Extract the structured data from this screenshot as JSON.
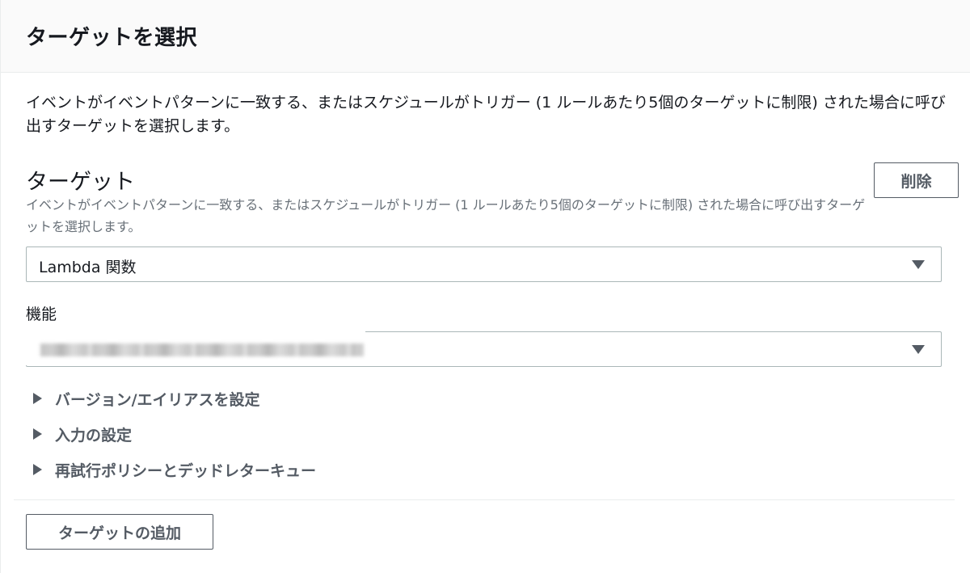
{
  "panel": {
    "title": "ターゲットを選択",
    "description": "イベントがイベントパターンに一致する、またはスケジュールがトリガー (1 ルールあたり5個のターゲットに制限) された場合に呼び出すターゲットを選択します。"
  },
  "target": {
    "heading": "ターゲット",
    "subtext": "イベントがイベントパターンに一致する、またはスケジュールがトリガー (1 ルールあたり5個のターゲットに制限) された場合に呼び出すターゲットを選択します。",
    "delete_label": "削除",
    "type_select_value": "Lambda 関数",
    "function_label": "機能",
    "function_select_value": ""
  },
  "expanders": [
    {
      "label": "バージョン/エイリアスを設定"
    },
    {
      "label": "入力の設定"
    },
    {
      "label": "再試行ポリシーとデッドレターキュー"
    }
  ],
  "footer": {
    "add_target_label": "ターゲットの追加"
  },
  "icons": {
    "select_caret": "caret-down-icon",
    "expander_arrow": "caret-right-icon"
  }
}
